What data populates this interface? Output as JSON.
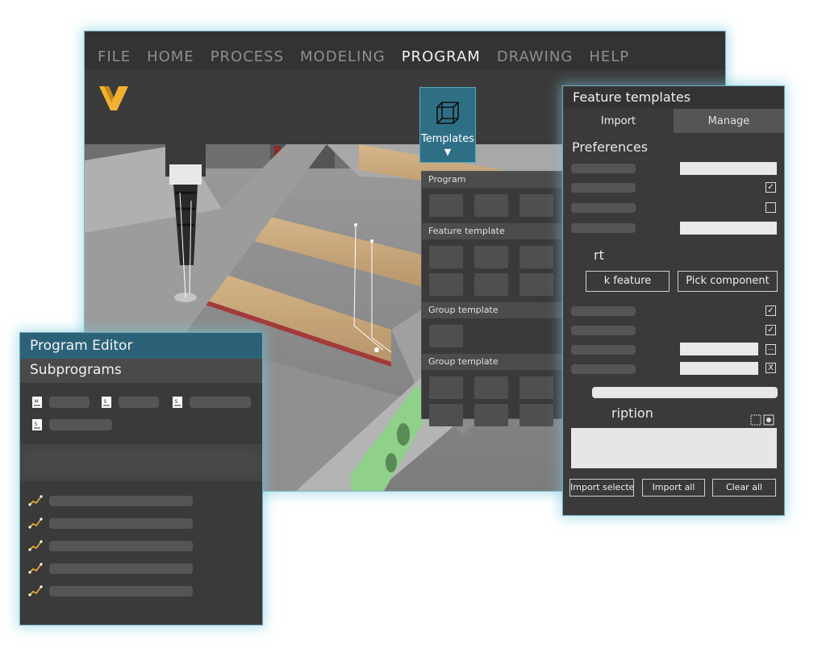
{
  "menu": {
    "items": [
      {
        "label": "FILE",
        "active": false
      },
      {
        "label": "HOME",
        "active": false
      },
      {
        "label": "PROCESS",
        "active": false
      },
      {
        "label": "MODELING",
        "active": false
      },
      {
        "label": "PROGRAM",
        "active": true
      },
      {
        "label": "DRAWING",
        "active": false
      },
      {
        "label": "HELP",
        "active": false
      }
    ]
  },
  "ribbon": {
    "templates_label": "Templates",
    "templates_arrow": "▼"
  },
  "colors": {
    "accent": "#2f6f85",
    "logo": "#f2b230",
    "weld_path": "#f2b230",
    "green_part": "#8fd08a"
  },
  "templates_dropdown": {
    "sections": [
      {
        "title": "Program",
        "tiles": 3
      },
      {
        "title": "Feature template",
        "tiles": 7
      },
      {
        "title": "Group template",
        "tiles": 1
      },
      {
        "title": "Group template",
        "tiles": 8
      }
    ]
  },
  "feature_panel": {
    "title": "Feature templates",
    "tabs": [
      {
        "label": "Import",
        "active": true
      },
      {
        "label": "Manage",
        "active": false
      }
    ],
    "preferences_heading": "Preferences",
    "checks": [
      "✓",
      "",
      "✓",
      "✓"
    ],
    "x_mark": "X",
    "dots_mark": "...",
    "section_heading_partial": "rt",
    "pick_feature_label": "k feature",
    "pick_component_label": "Pick component",
    "description_heading_partial": "ription",
    "buttons": {
      "import_selected": "Import selectec",
      "import_all": "Import all",
      "clear_all": "Clear all"
    }
  },
  "program_editor": {
    "title": "Program Editor",
    "subtitle": "Subprograms",
    "doc_icons": [
      "M",
      "S",
      "S",
      "S"
    ],
    "path_rows": 5
  }
}
